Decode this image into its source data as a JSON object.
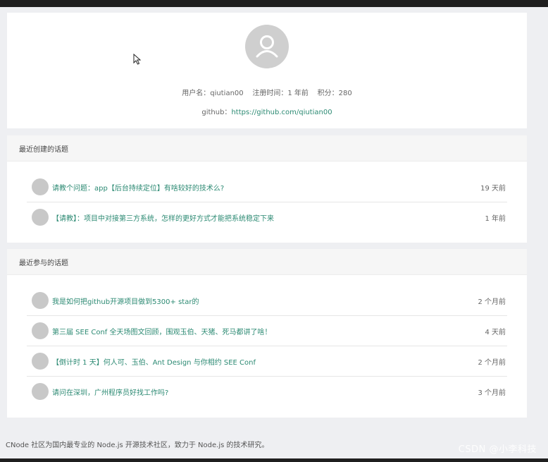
{
  "user": {
    "username_label": "用户名：",
    "username": "qiutian00",
    "register_label": "注册时间：",
    "register_value": "1 年前",
    "score_label": "积分：",
    "score_value": "280",
    "github_label": "github：",
    "github_url": "https://github.com/qiutian00"
  },
  "recent_created": {
    "title": "最近创建的话题",
    "topics": [
      {
        "title": "请教个问题：app【后台持续定位】有啥较好的技术么?",
        "time": "19 天前"
      },
      {
        "title": "【请教】：项目中对接第三方系统，怎样的更好方式才能把系统稳定下来",
        "time": "1 年前"
      }
    ]
  },
  "recent_joined": {
    "title": "最近参与的话题",
    "topics": [
      {
        "title": "我是如何把github开源项目做到5300+ star的",
        "time": "2 个月前"
      },
      {
        "title": "第三届 SEE Conf 全天场图文回顾，围观玉伯、天猪、死马都讲了啥！",
        "time": "4 天前"
      },
      {
        "title": "【倒计时 1 天】何人可、玉伯、Ant Design 与你相约 SEE Conf",
        "time": "2 个月前"
      },
      {
        "title": "请问在深圳，广州程序员好找工作吗?",
        "time": "3 个月前"
      }
    ]
  },
  "footer": {
    "text": "CNode 社区为国内最专业的 Node.js 开源技术社区，致力于 Node.js 的技术研究。"
  },
  "watermark": {
    "text": "CSDN @小李科技"
  },
  "icons": {
    "avatar": "user-avatar-icon",
    "cursor": "mouse-cursor-icon"
  },
  "colors": {
    "link": "#2c8a73",
    "background": "#eeeff2",
    "panel": "#ffffff"
  }
}
